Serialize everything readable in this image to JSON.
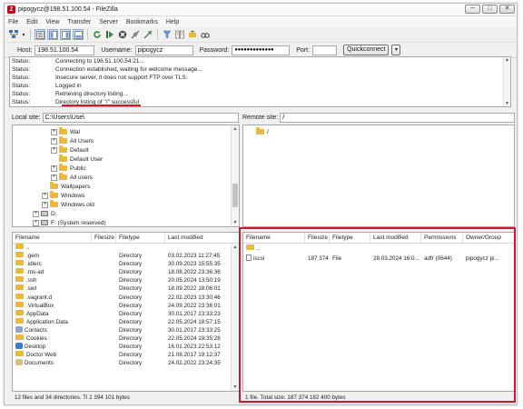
{
  "window": {
    "title": "pipogycz@198.51.100.54 - FileZilla",
    "minimize": "─",
    "maximize": "□",
    "close": "✕"
  },
  "menu": [
    "File",
    "Edit",
    "View",
    "Transfer",
    "Server",
    "Bookmarks",
    "Help"
  ],
  "toolbar_icons": [
    "site-manager-icon",
    "dropdown-icon",
    "message-log-icon",
    "local-tree-icon",
    "remote-tree-icon",
    "queue-icon",
    "refresh-icon",
    "process-queue-icon",
    "cancel-icon",
    "disconnect-icon",
    "reconnect-icon",
    "filter-icon",
    "compare-icon",
    "sync-browse-icon",
    "search-icon"
  ],
  "quickconnect": {
    "host_label": "Host:",
    "host_value": "198.51.100.54",
    "username_label": "Username:",
    "username_value": "pipogycz",
    "password_label": "Password:",
    "password_value": "●●●●●●●●●●●●●",
    "port_label": "Port:",
    "port_value": "",
    "button_label": "Quickconnect",
    "dropdown_label": "▾"
  },
  "log": [
    {
      "label": "Status:",
      "message": "Connecting to 198.51.100.54:21..."
    },
    {
      "label": "Status:",
      "message": "Connection established, waiting for welcome message..."
    },
    {
      "label": "Status:",
      "message": "Insecure server, it does not support FTP over TLS."
    },
    {
      "label": "Status:",
      "message": "Logged in"
    },
    {
      "label": "Status:",
      "message": "Retrieving directory listing..."
    },
    {
      "label": "Status:",
      "message": "Directory listing of \"/\" successful"
    }
  ],
  "local_site": {
    "label": "Local site:",
    "path": "C:\\Users\\Use\\"
  },
  "remote_site": {
    "label": "Remote site:",
    "path": "/"
  },
  "local_tree": [
    {
      "name": "Wal",
      "indent": 4,
      "type": "folder",
      "expander": "+"
    },
    {
      "name": "All Users",
      "indent": 4,
      "type": "folder",
      "expander": "+"
    },
    {
      "name": "Default",
      "indent": 4,
      "type": "folder",
      "expander": "+"
    },
    {
      "name": "Default User",
      "indent": 4,
      "type": "folder",
      "expander": ""
    },
    {
      "name": "Public",
      "indent": 4,
      "type": "folder",
      "expander": "+"
    },
    {
      "name": "All users",
      "indent": 4,
      "type": "folder",
      "expander": "+"
    },
    {
      "name": "Wallpapers",
      "indent": 3,
      "type": "folder",
      "expander": ""
    },
    {
      "name": "Windows",
      "indent": 3,
      "type": "folder",
      "expander": "+"
    },
    {
      "name": "Windows.old",
      "indent": 3,
      "type": "folder",
      "expander": "+"
    },
    {
      "name": "D:",
      "indent": 2,
      "type": "drive",
      "expander": "+"
    },
    {
      "name": "F: (System reserved)",
      "indent": 2,
      "type": "drive",
      "expander": "+"
    }
  ],
  "remote_tree": [
    {
      "name": "/",
      "type": "folder"
    }
  ],
  "local_files": {
    "headers": [
      "Filename",
      "Filesize",
      "Filetype",
      "Last modified"
    ],
    "rows": [
      {
        "name": "..",
        "size": "",
        "type": "",
        "modified": "",
        "icon": "folder"
      },
      {
        "name": ".gem",
        "size": "",
        "type": "Directory",
        "modified": "03.02.2023 11:27:45",
        "icon": "folder"
      },
      {
        "name": ".idlerc",
        "size": "",
        "type": "Directory",
        "modified": "30.09.2023 15:55:35",
        "icon": "folder"
      },
      {
        "name": ".ms-ad",
        "size": "",
        "type": "Directory",
        "modified": "18.08.2022 23:36:36",
        "icon": "folder"
      },
      {
        "name": ".ssh",
        "size": "",
        "type": "Directory",
        "modified": "20.05.2024 13:50:19",
        "icon": "folder"
      },
      {
        "name": ".swt",
        "size": "",
        "type": "Directory",
        "modified": "18.09.2022 18:06:01",
        "icon": "folder"
      },
      {
        "name": ".vagrant.d",
        "size": "",
        "type": "Directory",
        "modified": "22.02.2023 13:30:46",
        "icon": "folder"
      },
      {
        "name": ".VirtualBox",
        "size": "",
        "type": "Directory",
        "modified": "24.09.2022 23:36:01",
        "icon": "folder"
      },
      {
        "name": "AppData",
        "size": "",
        "type": "Directory",
        "modified": "30.01.2017 23:33:23",
        "icon": "folder"
      },
      {
        "name": "Application Data",
        "size": "",
        "type": "Directory",
        "modified": "22.05.2024 18:57:15",
        "icon": "folder"
      },
      {
        "name": "Contacts",
        "size": "",
        "type": "Directory",
        "modified": "30.01.2017 23:33:25",
        "icon": "contacts"
      },
      {
        "name": "Cookies",
        "size": "",
        "type": "Directory",
        "modified": "22.05.2024 19:35:28",
        "icon": "folder"
      },
      {
        "name": "Desktop",
        "size": "",
        "type": "Directory",
        "modified": "16.01.2023 22:53:12",
        "icon": "desktop"
      },
      {
        "name": "Doctor Web",
        "size": "",
        "type": "Directory",
        "modified": "21.08.2017 19:12:37",
        "icon": "folder"
      },
      {
        "name": "Documents",
        "size": "",
        "type": "Directory",
        "modified": "24.02.2022 23:24:35",
        "icon": "documents"
      }
    ],
    "status": "12 files and 34 directories. Tl 2 394 101 bytes"
  },
  "remote_files": {
    "headers": [
      "Filename",
      "Filesize",
      "Filetype",
      "Last modified",
      "Permissions",
      "Owner/Group"
    ],
    "rows": [
      {
        "name": "..",
        "size": "",
        "type": "",
        "modified": "",
        "permissions": "",
        "owner": "",
        "icon": "folder"
      },
      {
        "name": "iscsi",
        "size": "187 374 18...",
        "type": "File",
        "modified": "28.03.2024 16:0...",
        "permissions": "adfr (0644)",
        "owner": "pipogycz pi...",
        "icon": "file"
      }
    ],
    "status": "1 file. Total size: 187 374 182 400 bytes"
  },
  "colors": {
    "highlight": "#d0172a",
    "folder": "#e8b93a"
  }
}
